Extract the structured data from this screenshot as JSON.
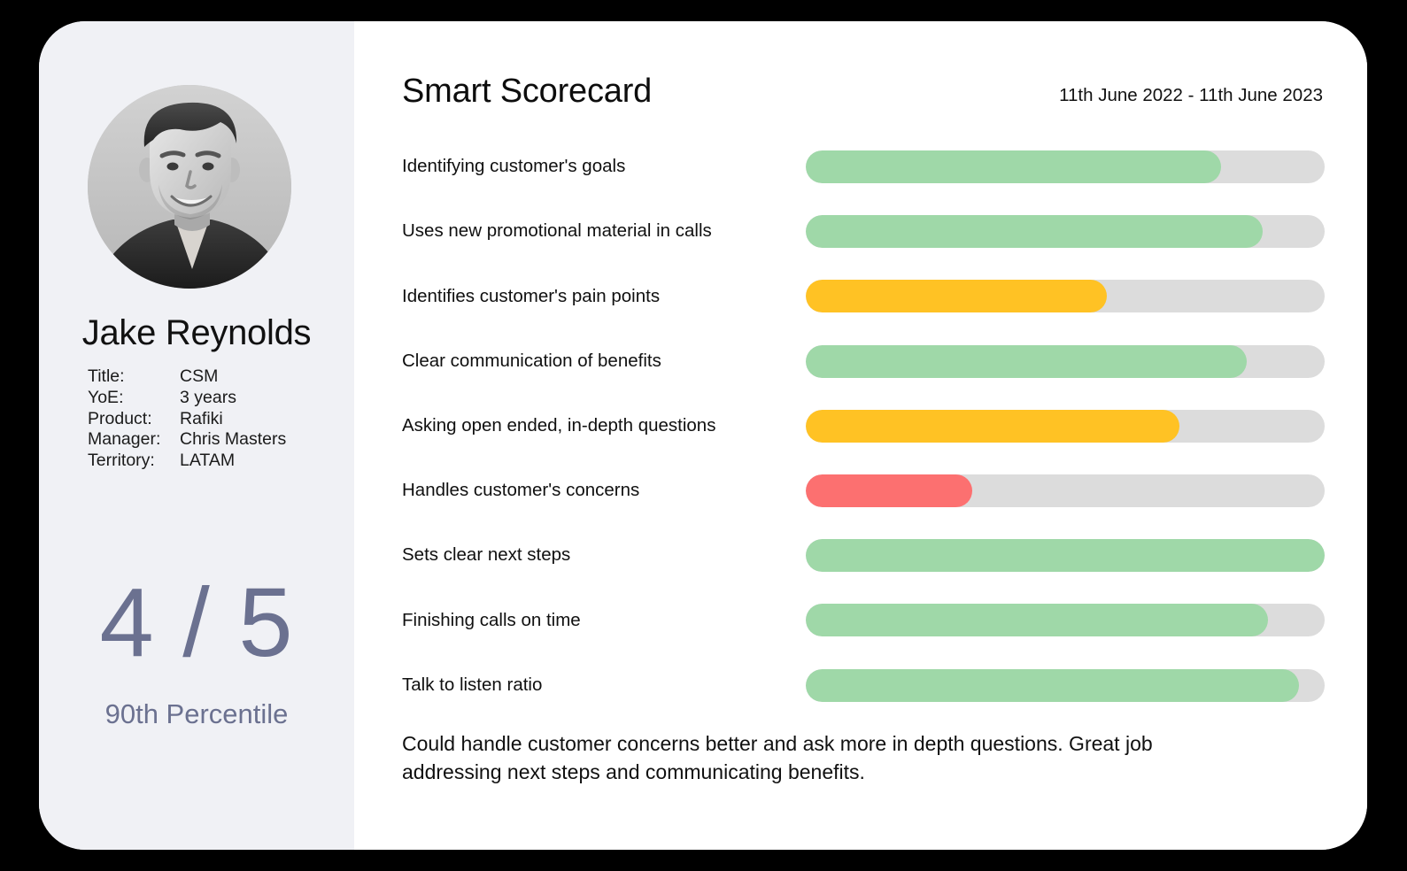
{
  "colors": {
    "good": "#9FD8A8",
    "warning": "#FFC224",
    "bad": "#FC7070",
    "track": "#DCDCDC",
    "sidebar_bg": "#F0F1F5",
    "score_text": "#6B7190",
    "card_bg": "#FFFFFF",
    "page_bg": "#000000"
  },
  "sidebar": {
    "avatar_alt": "avatar-photo",
    "name": "Jake Reynolds",
    "details": [
      {
        "label": "Title:",
        "value": "CSM"
      },
      {
        "label": "YoE:",
        "value": "3 years"
      },
      {
        "label": "Product:",
        "value": "Rafiki"
      },
      {
        "label": "Manager:",
        "value": "Chris Masters"
      },
      {
        "label": "Territory:",
        "value": "LATAM"
      }
    ],
    "score": "4 / 5",
    "percentile": "90th Percentile"
  },
  "main": {
    "title": "Smart Scorecard",
    "date_range": "11th June 2022 - 11th June 2023",
    "summary": "Could handle customer concerns better and ask more in depth questions. Great job addressing next steps and communicating benefits."
  },
  "chart_data": {
    "type": "bar",
    "title": "Smart Scorecard",
    "orientation": "horizontal",
    "xlim": [
      0,
      100
    ],
    "ylabel": "",
    "xlabel": "",
    "grid": false,
    "legend": "none",
    "categories": [
      "Identifying customer's goals",
      "Uses new promotional material in calls",
      "Identifies customer's pain points",
      "Clear communication of benefits",
      "Asking open ended, in-depth questions",
      "Handles customer's concerns",
      "Sets clear next steps",
      "Finishing calls on time",
      "Talk to listen ratio"
    ],
    "values": [
      80,
      88,
      58,
      85,
      72,
      32,
      100,
      89,
      95
    ],
    "colors": [
      "#9FD8A8",
      "#9FD8A8",
      "#FFC224",
      "#9FD8A8",
      "#FFC224",
      "#FC7070",
      "#9FD8A8",
      "#9FD8A8",
      "#9FD8A8"
    ]
  }
}
